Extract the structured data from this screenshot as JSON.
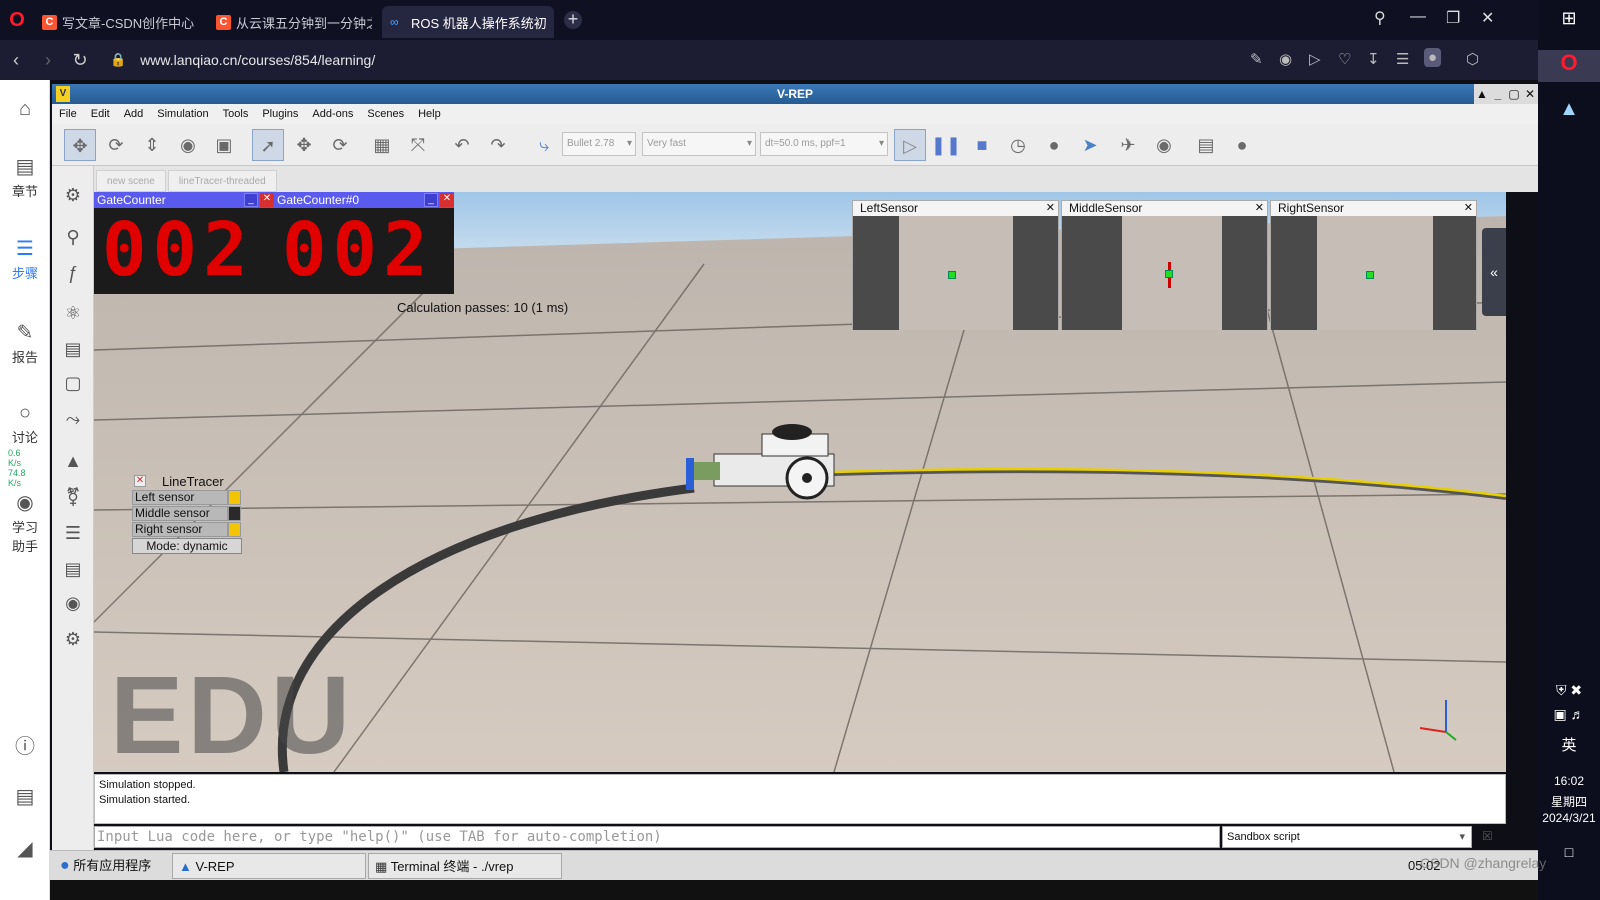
{
  "browser": {
    "tabs": [
      {
        "label": "写文章-CSDN创作中心",
        "icon": "csdn-icon"
      },
      {
        "label": "从云课五分钟到一分钟之v",
        "icon": "csdn-icon"
      },
      {
        "label": "ROS 机器人操作系统初级",
        "icon": "lanqiao-icon"
      }
    ],
    "new_tab": "+",
    "url": "www.lanqiao.cn/courses/854/learning/"
  },
  "lanqiao_sidebar": {
    "items": [
      {
        "label": "",
        "icon": "home-icon"
      },
      {
        "label": "章节",
        "icon": "chapters-icon"
      },
      {
        "label": "步骤",
        "icon": "steps-icon"
      },
      {
        "label": "报告",
        "icon": "report-icon"
      },
      {
        "label": "讨论",
        "icon": "discussion-icon"
      },
      {
        "label": "学习助手",
        "icon": "assistant-icon"
      }
    ],
    "net_speed": [
      "0.6",
      "K/s",
      "74.8",
      "K/s"
    ]
  },
  "vrep": {
    "title": "V-REP",
    "menu": [
      "File",
      "Edit",
      "Add",
      "Simulation",
      "Tools",
      "Plugins",
      "Add-ons",
      "Scenes",
      "Help"
    ],
    "engine": "Bullet 2.78",
    "speed": "Very fast",
    "timestep": "dt=50.0 ms, ppf=1",
    "scene_tabs": [
      "new scene",
      "lineTracer-threaded"
    ],
    "gate_counters": [
      {
        "title": "GateCounter",
        "value": "002"
      },
      {
        "title": "GateCounter#0",
        "value": "002"
      }
    ],
    "calc_passes": "Calculation passes: 10 (1 ms)",
    "sensors": [
      "LeftSensor",
      "MiddleSensor",
      "RightSensor"
    ],
    "line_tracer": {
      "title": "LineTracer",
      "rows": [
        {
          "label": "Left sensor",
          "color": "#f5c400"
        },
        {
          "label": "Middle sensor",
          "color": "#2a2a2a"
        },
        {
          "label": "Right sensor",
          "color": "#f5c400"
        }
      ],
      "mode": "Mode: dynamic"
    },
    "watermark": "EDU",
    "console": [
      "Simulation stopped.",
      "Simulation started."
    ],
    "lua_placeholder": "Input Lua code here, or type \"help()\" (use TAB for auto-completion)",
    "script_type": "Sandbox script"
  },
  "taskbar": {
    "apps": "所有应用程序",
    "vrep": "V-REP",
    "terminal": "Terminal 终端 - ./vrep",
    "clock": "05:02"
  },
  "system": {
    "ime": "英",
    "time": "16:02",
    "weekday": "星期四",
    "date": "2024/3/21",
    "watermark": "CSDN @zhangrelay"
  }
}
